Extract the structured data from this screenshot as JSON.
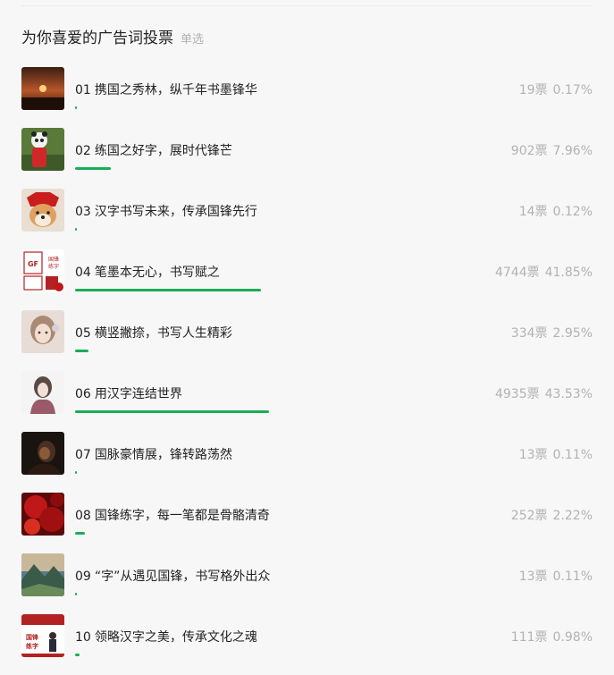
{
  "vote": {
    "title": "为你喜爱的广告词投票",
    "mode": "单选"
  },
  "options": [
    {
      "num": "01",
      "text": "携国之秀林，纵千年书墨锋华",
      "votes": "19票",
      "percent": "0.17%",
      "share": 0.17,
      "thumb": "sunset-photo"
    },
    {
      "num": "02",
      "text": "练国之好字，展时代锋芒",
      "votes": "902票",
      "percent": "7.96%",
      "share": 7.96,
      "thumb": "panda-costume-photo"
    },
    {
      "num": "03",
      "text": "汉字书写未来，传承国锋先行",
      "votes": "14票",
      "percent": "0.12%",
      "share": 0.12,
      "thumb": "shiba-dog-photo"
    },
    {
      "num": "04",
      "text": "笔墨本无心，书写赋之",
      "votes": "4744票",
      "percent": "41.85%",
      "share": 41.85,
      "thumb": "brand-logo-image",
      "logo_text": [
        "GF",
        "国锋",
        "练字"
      ]
    },
    {
      "num": "05",
      "text": "横竖撇捺，书写人生精彩",
      "votes": "334票",
      "percent": "2.95%",
      "share": 2.95,
      "thumb": "girl-portrait-photo"
    },
    {
      "num": "06",
      "text": "用汉字连结世界",
      "votes": "4935票",
      "percent": "43.53%",
      "share": 43.53,
      "thumb": "scarf-portrait-photo"
    },
    {
      "num": "07",
      "text": "国脉豪情展，锋转路荡然",
      "votes": "13票",
      "percent": "0.11%",
      "share": 0.11,
      "thumb": "dark-portrait-photo"
    },
    {
      "num": "08",
      "text": "国锋练字，每一笔都是骨骼清奇",
      "votes": "252票",
      "percent": "2.22%",
      "share": 2.22,
      "thumb": "red-pattern-photo"
    },
    {
      "num": "09",
      "text": "“字”从遇见国锋，书写格外出众",
      "votes": "13票",
      "percent": "0.11%",
      "share": 0.11,
      "thumb": "mountain-landscape-photo"
    },
    {
      "num": "10",
      "text": "领略汉字之美，传承文化之魂",
      "votes": "111票",
      "percent": "0.98%",
      "share": 0.98,
      "thumb": "brand-poster-image",
      "logo_text": [
        "国锋",
        "练字"
      ]
    }
  ],
  "colors": {
    "bar": "#1aad56",
    "muted_text": "#b2b2b2",
    "background": "#f7f7f7"
  }
}
